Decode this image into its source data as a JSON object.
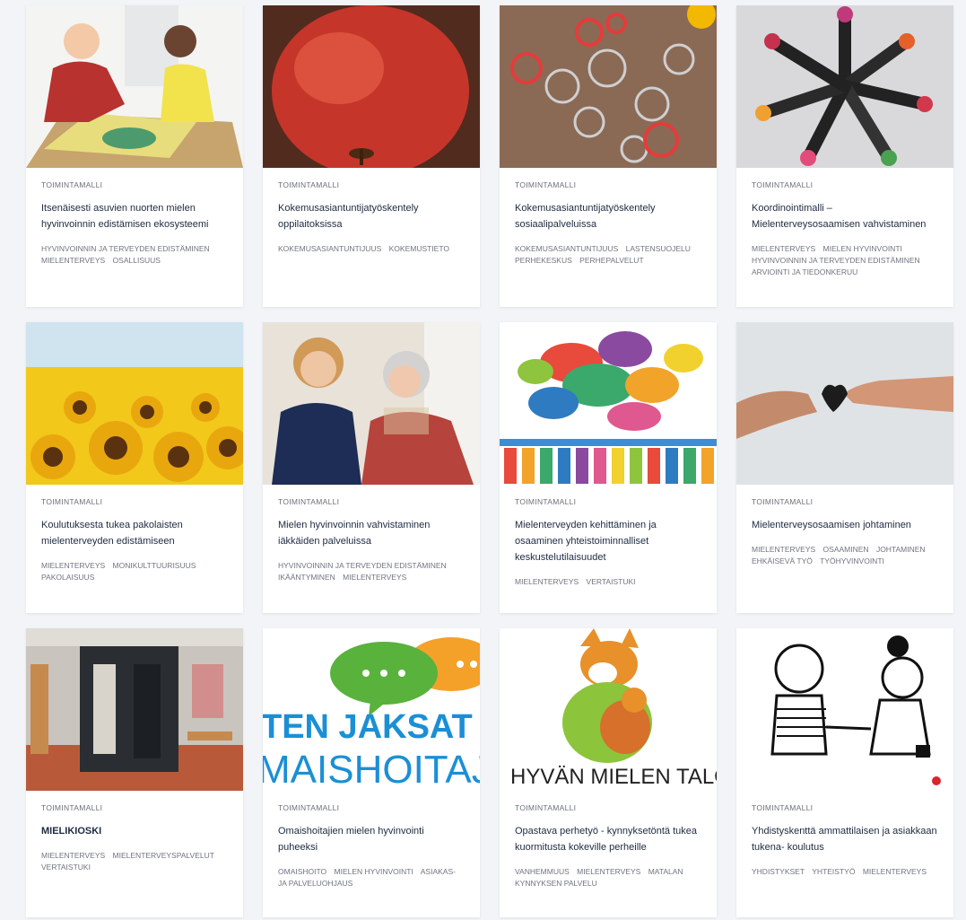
{
  "cards": [
    {
      "kind": "TOIMINTAMALLI",
      "title": "Itsenäisesti asuvien nuorten mielen hyvinvoinnin edistämisen ekosysteemi",
      "tags": [
        "HYVINVOINNIN JA TERVEYDEN EDISTÄMINEN",
        "MIELENTERVEYS",
        "OSALLISUUS"
      ]
    },
    {
      "kind": "TOIMINTAMALLI",
      "title": "Kokemusasiantuntijatyöskentely oppilaitoksissa",
      "tags": [
        "KOKEMUSASIANTUNTIJUUS",
        "KOKEMUSTIETO"
      ]
    },
    {
      "kind": "TOIMINTAMALLI",
      "title": "Kokemusasiantuntijatyöskentely sosiaalipalveluissa",
      "tags": [
        "KOKEMUSASIANTUNTIJUUS",
        "LASTENSUOJELU",
        "PERHEKESKUS",
        "PERHEPALVELUT"
      ]
    },
    {
      "kind": "TOIMINTAMALLI",
      "title": "Koordinointimalli – Mielenterveysosaamisen vahvistaminen",
      "tags": [
        "MIELENTERVEYS",
        "MIELEN HYVINVOINTI",
        "HYVINVOINNIN JA TERVEYDEN EDISTÄMINEN",
        "ARVIOINTI JA TIEDONKERUU"
      ]
    },
    {
      "kind": "TOIMINTAMALLI",
      "title": "Koulutuksesta tukea pakolaisten mielenterveyden edistämiseen",
      "tags": [
        "MIELENTERVEYS",
        "MONIKULTTUURISUUS",
        "PAKOLAISUUS"
      ]
    },
    {
      "kind": "TOIMINTAMALLI",
      "title": "Mielen hyvinvoinnin vahvistaminen iäkkäiden palveluissa",
      "tags": [
        "HYVINVOINNIN JA TERVEYDEN EDISTÄMINEN",
        "IKÄÄNTYMINEN",
        "MIELENTERVEYS"
      ]
    },
    {
      "kind": "TOIMINTAMALLI",
      "title": "Mielenterveyden kehittäminen ja osaaminen yhteistoiminnalliset keskustelutilaisuudet",
      "tags": [
        "MIELENTERVEYS",
        "VERTAISTUKI"
      ]
    },
    {
      "kind": "TOIMINTAMALLI",
      "title": "Mielenterveysosaamisen johtaminen",
      "tags": [
        "MIELENTERVEYS",
        "OSAAMINEN",
        "JOHTAMINEN",
        "EHKÄISEVÄ TYÖ",
        "TYÖHYVINVOINTI"
      ]
    },
    {
      "kind": "TOIMINTAMALLI",
      "title": "MIELIKIOSKI",
      "tags": [
        "MIELENTERVEYS",
        "MIELENTERVEYSPALVELUT",
        "VERTAISTUKI"
      ]
    },
    {
      "kind": "TOIMINTAMALLI",
      "title": "Omaishoitajien mielen hyvinvointi puheeksi",
      "tags": [
        "OMAISHOITO",
        "MIELEN HYVINVOINTI",
        "ASIAKAS- JA PALVELUOHJAUS"
      ]
    },
    {
      "kind": "TOIMINTAMALLI",
      "title": "Opastava perhetyö - kynnyksetöntä tukea kuormitusta kokeville perheille",
      "tags": [
        "VANHEMMUUS",
        "MIELENTERVEYS",
        "MATALAN KYNNYKSEN PALVELU"
      ]
    },
    {
      "kind": "TOIMINTAMALLI",
      "title": "Yhdistyskenttä ammattilaisen ja asiakkaan tukena- koulutus",
      "tags": [
        "YHDISTYKSET",
        "YHTEISTYÖ",
        "MIELENTERVEYS"
      ]
    }
  ],
  "image_text": {
    "omaishoitaja_line1": "TEN JAKSAT",
    "omaishoitaja_line2": "MAISHOITAJA",
    "hyvan_mielen_talo": "HYVÄN MIELEN TALO"
  }
}
